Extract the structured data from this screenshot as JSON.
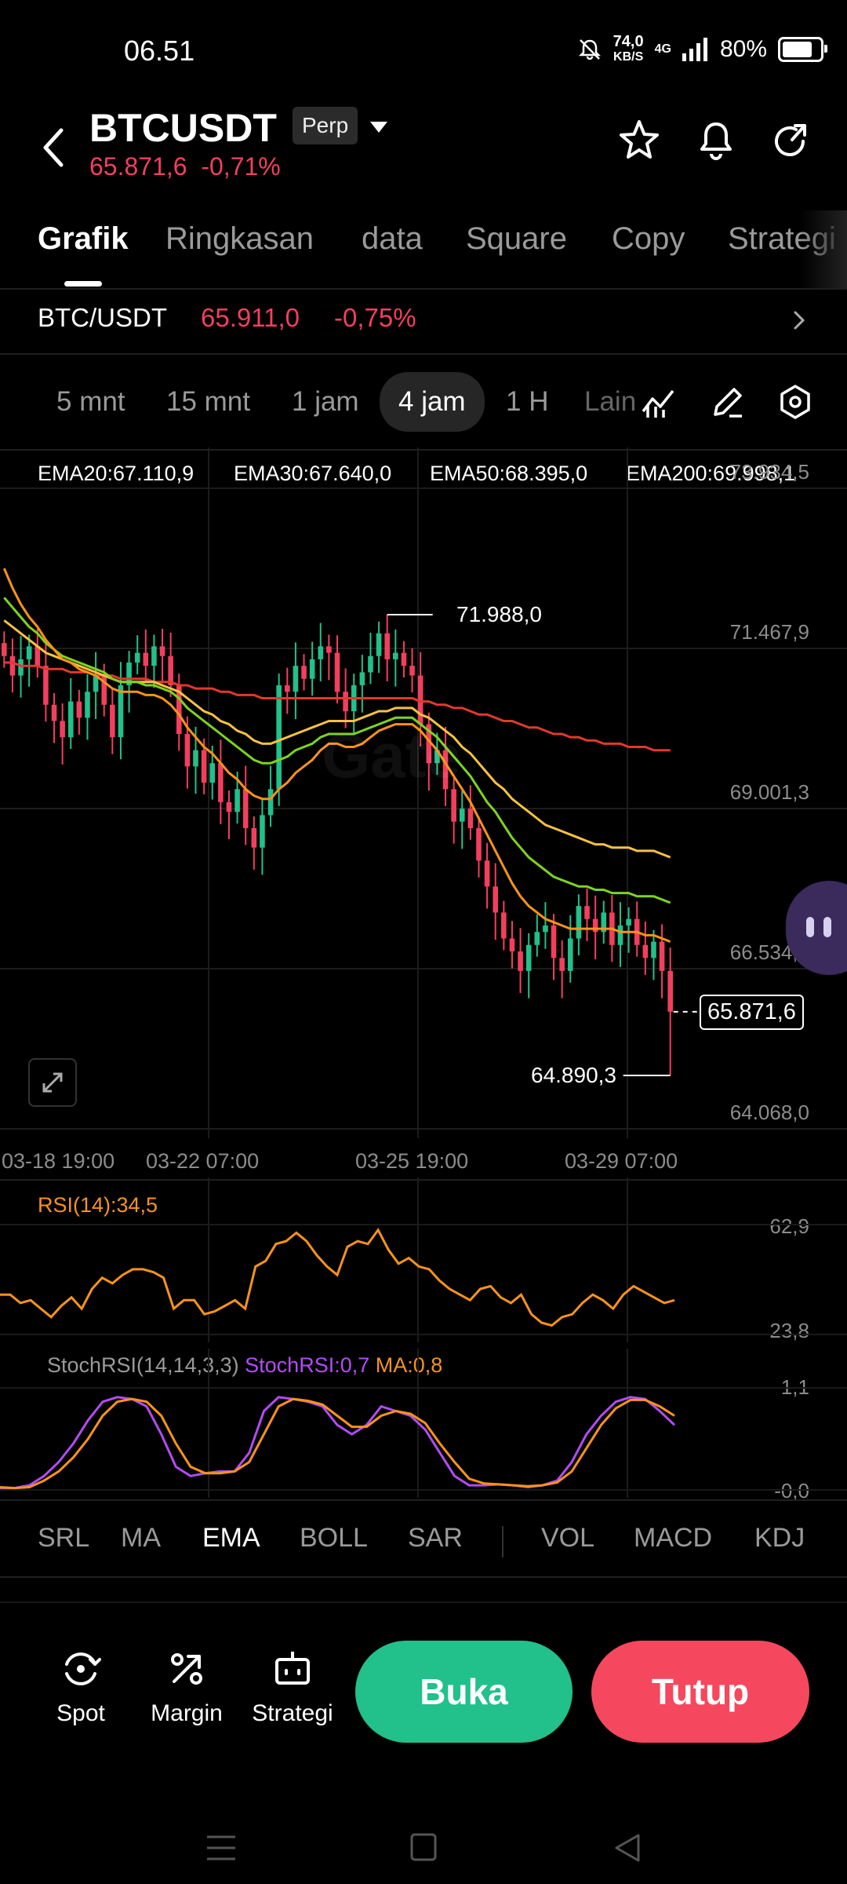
{
  "status_bar": {
    "time": "06.51",
    "net_speed_value": "74,0",
    "net_speed_unit": "KB/S",
    "network": "4G",
    "battery": "80%",
    "battery_level": 0.8
  },
  "header": {
    "symbol": "BTCUSDT",
    "contract_badge": "Perp",
    "last_price": "65.871,6",
    "change": "-0,71%"
  },
  "tabs": [
    {
      "label": "Grafik",
      "active": true
    },
    {
      "label": "Ringkasan",
      "active": false
    },
    {
      "label": "data",
      "active": false
    },
    {
      "label": "Square",
      "active": false
    },
    {
      "label": "Copy",
      "active": false
    },
    {
      "label": "Strategi",
      "active": false
    }
  ],
  "pair_row": {
    "pair": "BTC/USDT",
    "price": "65.911,0",
    "change": "-0,75%"
  },
  "intervals": [
    {
      "label": "5 mnt",
      "active": false
    },
    {
      "label": "15 mnt",
      "active": false
    },
    {
      "label": "1 jam",
      "active": false
    },
    {
      "label": "4 jam",
      "active": true
    },
    {
      "label": "1 H",
      "active": false
    },
    {
      "label": "Lain",
      "active": false
    }
  ],
  "colors": {
    "up": "#22c08a",
    "down": "#f23f5e",
    "ema20": "#f7931a",
    "ema30": "#7ed321",
    "ema50": "#f5c242",
    "ema200": "#e0392e",
    "rsi": "#f7931a",
    "stoch": "#b14cf2",
    "stoch_ma": "#f7931a"
  },
  "chart_data": [
    {
      "type": "candlestick",
      "ylim": [
        64068.0,
        73934.5
      ],
      "y_ticks": [
        "73.934,5",
        "71.467,9",
        "69.001,3",
        "66.534,7",
        "64.068,0"
      ],
      "y_tick_values": [
        73934.5,
        71467.9,
        69001.3,
        66534.7,
        64068.0
      ],
      "x_ticks": [
        "03-18 19:00",
        "03-22 07:00",
        "03-25 19:00",
        "03-29 07:00"
      ],
      "legend": [
        {
          "label": "EMA20:67.110,9",
          "color": "#f7931a"
        },
        {
          "label": "EMA30:67.640,0",
          "color": "#7ed321"
        },
        {
          "label": "EMA50:68.395,0",
          "color": "#f5c242"
        },
        {
          "label": "EMA200:69.998,1",
          "color": "#e0392e"
        }
      ],
      "annotations": {
        "high": "71.988,0",
        "high_value": 71988.0,
        "low": "64.890,3",
        "low_value": 64890.3,
        "last": "65.871,6",
        "last_value": 65871.6
      },
      "close": [
        71350,
        71050,
        71300,
        71500,
        71200,
        70600,
        70350,
        70100,
        70650,
        70400,
        70800,
        71050,
        70600,
        70100,
        70900,
        71250,
        71400,
        71200,
        71500,
        71350,
        70900,
        70150,
        69650,
        69900,
        69400,
        69700,
        69100,
        68950,
        69300,
        68700,
        68400,
        68900,
        69300,
        70900,
        70800,
        71200,
        71000,
        71300,
        71500,
        71400,
        70800,
        70500,
        70900,
        71100,
        71350,
        71700,
        71300,
        71400,
        71200,
        71050,
        70300,
        69700,
        69900,
        69300,
        68800,
        69000,
        68700,
        68200,
        67800,
        67400,
        67000,
        66800,
        66500,
        66900,
        67100,
        67200,
        66700,
        66500,
        67000,
        67500,
        67300,
        67100,
        67400,
        66900,
        67200,
        67300,
        66900,
        66700,
        66950,
        66500,
        65871.6
      ],
      "ema20": [
        72700,
        72400,
        72150,
        71950,
        71800,
        71600,
        71450,
        71300,
        71250,
        71150,
        71100,
        71050,
        70950,
        70850,
        70800,
        70800,
        70800,
        70750,
        70750,
        70700,
        70600,
        70450,
        70250,
        70100,
        69950,
        69850,
        69700,
        69550,
        69450,
        69300,
        69200,
        69150,
        69150,
        69300,
        69400,
        69550,
        69650,
        69750,
        69900,
        70000,
        70000,
        69950,
        69950,
        70000,
        70100,
        70200,
        70250,
        70300,
        70300,
        70300,
        70200,
        70050,
        69900,
        69700,
        69500,
        69300,
        69100,
        68850,
        68600,
        68350,
        68100,
        67850,
        67650,
        67500,
        67400,
        67300,
        67250,
        67200,
        67150,
        67150,
        67150,
        67150,
        67150,
        67150,
        67100,
        67100,
        67100,
        67050,
        67050,
        67000,
        66950
      ],
      "ema30": [
        72250,
        72100,
        71950,
        71800,
        71700,
        71550,
        71450,
        71350,
        71300,
        71250,
        71200,
        71150,
        71100,
        71000,
        70950,
        70950,
        70950,
        70900,
        70900,
        70850,
        70800,
        70700,
        70550,
        70450,
        70350,
        70250,
        70150,
        70050,
        69950,
        69850,
        69750,
        69700,
        69700,
        69750,
        69800,
        69900,
        69950,
        70000,
        70100,
        70150,
        70150,
        70150,
        70150,
        70200,
        70250,
        70300,
        70350,
        70400,
        70400,
        70400,
        70300,
        70200,
        70100,
        69950,
        69800,
        69650,
        69500,
        69300,
        69100,
        68950,
        68750,
        68550,
        68400,
        68250,
        68150,
        68050,
        67950,
        67900,
        67850,
        67800,
        67800,
        67750,
        67750,
        67700,
        67700,
        67700,
        67650,
        67650,
        67650,
        67600,
        67550
      ],
      "ema50": [
        71900,
        71800,
        71700,
        71600,
        71500,
        71400,
        71350,
        71300,
        71250,
        71200,
        71150,
        71100,
        71050,
        71000,
        70950,
        70950,
        70950,
        70950,
        70950,
        70900,
        70850,
        70800,
        70700,
        70600,
        70500,
        70450,
        70350,
        70300,
        70200,
        70150,
        70050,
        70000,
        70000,
        70050,
        70100,
        70150,
        70200,
        70250,
        70300,
        70350,
        70350,
        70350,
        70350,
        70400,
        70450,
        70500,
        70500,
        70550,
        70550,
        70550,
        70450,
        70400,
        70300,
        70200,
        70100,
        69950,
        69850,
        69700,
        69550,
        69400,
        69300,
        69150,
        69050,
        68950,
        68850,
        68750,
        68700,
        68650,
        68600,
        68550,
        68500,
        68450,
        68450,
        68400,
        68400,
        68400,
        68350,
        68350,
        68350,
        68300,
        68250
      ],
      "ema200": [
        71250,
        71250,
        71200,
        71200,
        71200,
        71150,
        71150,
        71150,
        71100,
        71100,
        71100,
        71050,
        71050,
        71050,
        71000,
        71000,
        71000,
        71000,
        70950,
        70950,
        70950,
        70900,
        70900,
        70850,
        70850,
        70850,
        70800,
        70800,
        70750,
        70750,
        70750,
        70700,
        70700,
        70700,
        70700,
        70700,
        70700,
        70700,
        70700,
        70700,
        70700,
        70700,
        70700,
        70700,
        70700,
        70700,
        70700,
        70700,
        70700,
        70700,
        70650,
        70650,
        70600,
        70600,
        70550,
        70550,
        70500,
        70450,
        70450,
        70400,
        70350,
        70350,
        70300,
        70250,
        70250,
        70200,
        70150,
        70150,
        70100,
        70100,
        70050,
        70050,
        70000,
        70000,
        70000,
        69950,
        69950,
        69950,
        69900,
        69900,
        69900
      ]
    },
    {
      "type": "line",
      "title": "RSI(14):34,5",
      "ylim": [
        23.8,
        62.9
      ],
      "y_ticks": [
        "62,9",
        "23,8"
      ],
      "series": [
        {
          "name": "RSI(14)",
          "values": [
            38,
            38,
            35,
            36,
            33,
            30,
            34,
            37,
            33,
            40,
            44,
            42,
            45,
            47,
            47,
            46,
            44,
            33,
            36,
            36,
            31,
            32,
            34,
            36,
            33,
            48,
            50,
            56,
            57,
            60,
            57,
            52,
            48,
            45,
            55,
            57,
            56,
            61,
            54,
            49,
            51,
            48,
            47,
            43,
            40,
            38,
            36,
            40,
            41,
            37,
            35,
            38,
            31,
            28,
            27,
            30,
            31,
            35,
            38,
            36,
            33,
            38,
            41,
            39,
            37,
            35,
            36
          ]
        }
      ]
    },
    {
      "type": "line",
      "title": "StochRSI(14,14,3,3)",
      "ylim": [
        -0.0,
        1.1
      ],
      "y_ticks": [
        "1,1",
        "-0,0"
      ],
      "series": [
        {
          "name": "StochRSI:0,7",
          "values": [
            0.02,
            0.02,
            0.05,
            0.15,
            0.3,
            0.5,
            0.75,
            0.95,
            1.0,
            0.98,
            0.9,
            0.6,
            0.25,
            0.15,
            0.18,
            0.2,
            0.2,
            0.4,
            0.85,
            1.0,
            0.98,
            0.95,
            0.9,
            0.7,
            0.6,
            0.7,
            0.9,
            0.85,
            0.8,
            0.65,
            0.4,
            0.15,
            0.05,
            0.05,
            0.06,
            0.05,
            0.03,
            0.05,
            0.1,
            0.3,
            0.6,
            0.8,
            0.95,
            1.0,
            0.98,
            0.85,
            0.7
          ]
        },
        {
          "name": "MA:0,8",
          "values": [
            0.03,
            0.02,
            0.03,
            0.1,
            0.2,
            0.35,
            0.55,
            0.8,
            0.95,
            0.98,
            0.95,
            0.8,
            0.5,
            0.25,
            0.18,
            0.18,
            0.2,
            0.3,
            0.6,
            0.9,
            0.98,
            0.96,
            0.92,
            0.8,
            0.68,
            0.68,
            0.8,
            0.85,
            0.82,
            0.72,
            0.5,
            0.3,
            0.12,
            0.07,
            0.06,
            0.05,
            0.04,
            0.05,
            0.08,
            0.2,
            0.45,
            0.7,
            0.88,
            0.97,
            0.97,
            0.9,
            0.8
          ]
        }
      ]
    }
  ],
  "stoch_legend": {
    "title": "StochRSI(14,14,3,3)",
    "stoch": "StochRSI:0,7",
    "ma": "MA:0,8"
  },
  "indicator_tabs": [
    {
      "label": "SRL",
      "active": false
    },
    {
      "label": "MA",
      "active": false
    },
    {
      "label": "EMA",
      "active": true
    },
    {
      "label": "BOLL",
      "active": false
    },
    {
      "label": "SAR",
      "active": false
    },
    {
      "label": "VOL",
      "active": false
    },
    {
      "label": "MACD",
      "active": false
    },
    {
      "label": "KDJ",
      "active": false
    }
  ],
  "actions": {
    "spot": "Spot",
    "margin": "Margin",
    "strategi": "Strategi",
    "open": "Buka",
    "close": "Tutup"
  }
}
